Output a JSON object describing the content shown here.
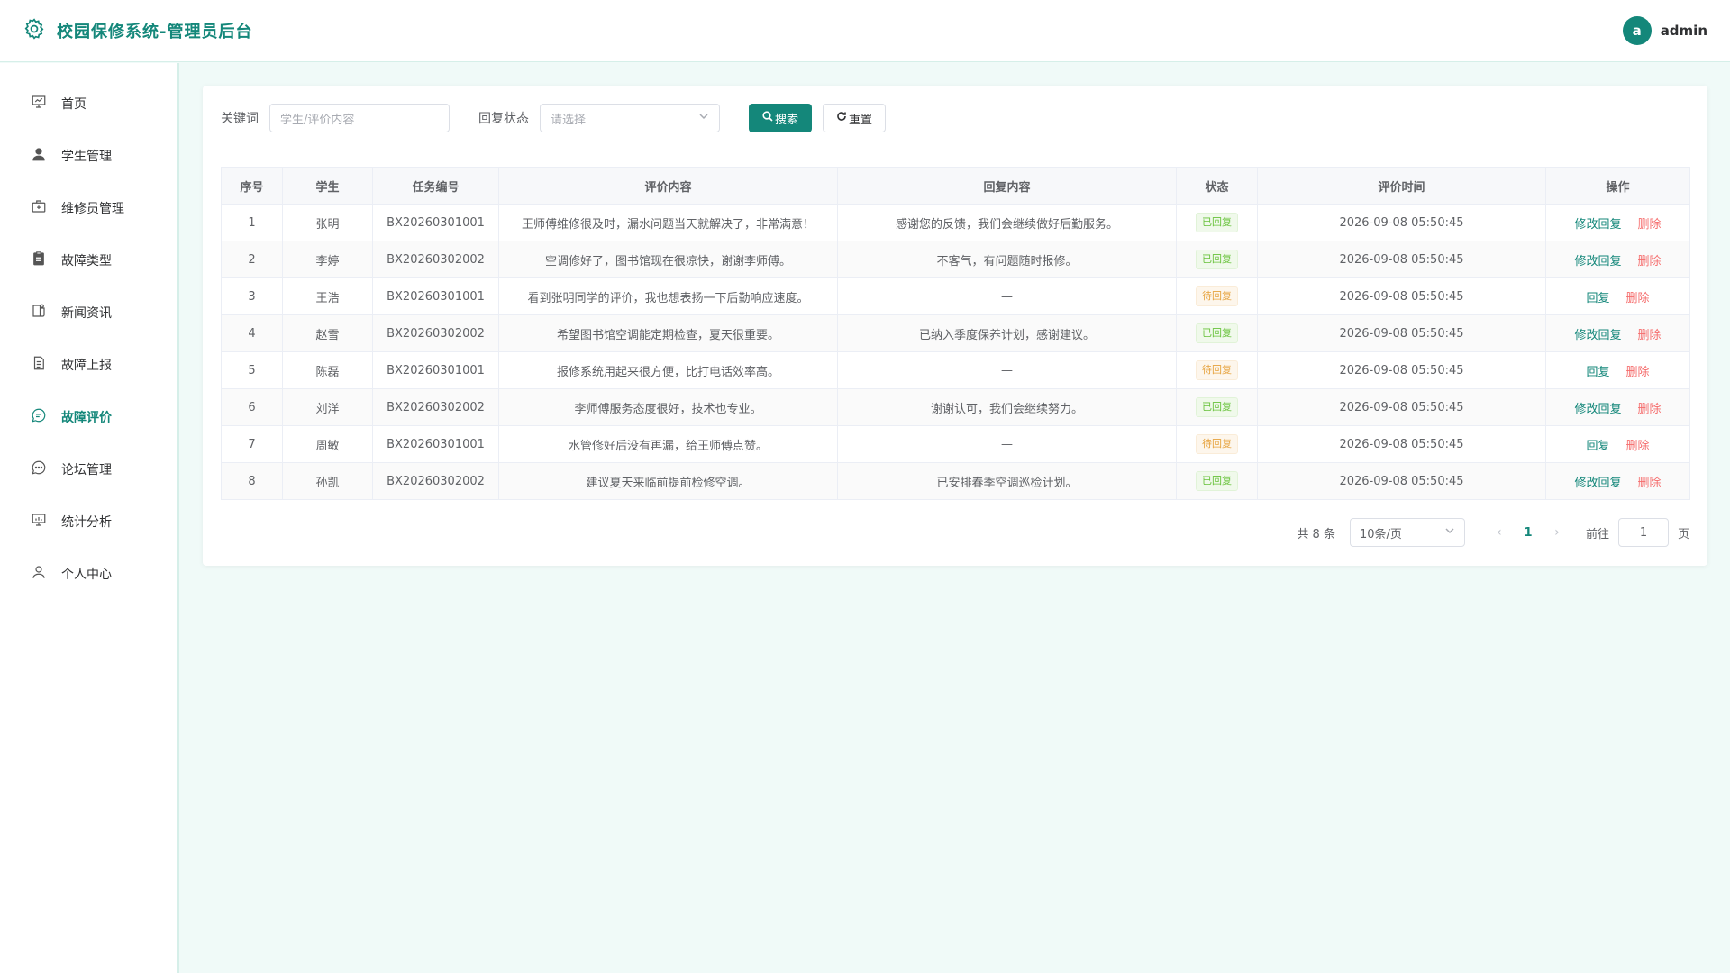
{
  "header": {
    "title": "校园保修系统-管理员后台",
    "avatar_letter": "a",
    "username": "admin"
  },
  "sidebar": {
    "items": [
      {
        "label": "首页",
        "icon": "chalkboard-icon"
      },
      {
        "label": "学生管理",
        "icon": "user-icon"
      },
      {
        "label": "维修员管理",
        "icon": "toolbox-icon"
      },
      {
        "label": "故障类型",
        "icon": "clipboard-icon"
      },
      {
        "label": "新闻资讯",
        "icon": "news-icon"
      },
      {
        "label": "故障上报",
        "icon": "document-icon"
      },
      {
        "label": "故障评价",
        "icon": "chat-icon",
        "active": true
      },
      {
        "label": "论坛管理",
        "icon": "chat-dots-icon"
      },
      {
        "label": "统计分析",
        "icon": "chart-icon"
      },
      {
        "label": "个人中心",
        "icon": "person-icon"
      }
    ]
  },
  "filters": {
    "keyword_label": "关键词",
    "keyword_placeholder": "学生/评价内容",
    "status_label": "回复状态",
    "status_placeholder": "请选择",
    "search_button": "搜索",
    "reset_button": "重置"
  },
  "table": {
    "columns": [
      "序号",
      "学生",
      "任务编号",
      "评价内容",
      "回复内容",
      "状态",
      "评价时间",
      "操作"
    ],
    "rows": [
      {
        "index": "1",
        "student": "张明",
        "task_no": "BX20260301001",
        "content": "王师傅维修很及时，漏水问题当天就解决了，非常满意！",
        "reply": "感谢您的反馈，我们会继续做好后勤服务。",
        "status": "已回复",
        "status_type": "ok",
        "time": "2026-09-08 05:50:45",
        "action": "修改回复",
        "delete": "删除"
      },
      {
        "index": "2",
        "student": "李婷",
        "task_no": "BX20260302002",
        "content": "空调修好了，图书馆现在很凉快，谢谢李师傅。",
        "reply": "不客气，有问题随时报修。",
        "status": "已回复",
        "status_type": "ok",
        "time": "2026-09-08 05:50:45",
        "action": "修改回复",
        "delete": "删除"
      },
      {
        "index": "3",
        "student": "王浩",
        "task_no": "BX20260301001",
        "content": "看到张明同学的评价，我也想表扬一下后勤响应速度。",
        "reply": "—",
        "status": "待回复",
        "status_type": "wait",
        "time": "2026-09-08 05:50:45",
        "action": "回复",
        "delete": "删除"
      },
      {
        "index": "4",
        "student": "赵雪",
        "task_no": "BX20260302002",
        "content": "希望图书馆空调能定期检查，夏天很重要。",
        "reply": "已纳入季度保养计划，感谢建议。",
        "status": "已回复",
        "status_type": "ok",
        "time": "2026-09-08 05:50:45",
        "action": "修改回复",
        "delete": "删除"
      },
      {
        "index": "5",
        "student": "陈磊",
        "task_no": "BX20260301001",
        "content": "报修系统用起来很方便，比打电话效率高。",
        "reply": "—",
        "status": "待回复",
        "status_type": "wait",
        "time": "2026-09-08 05:50:45",
        "action": "回复",
        "delete": "删除"
      },
      {
        "index": "6",
        "student": "刘洋",
        "task_no": "BX20260302002",
        "content": "李师傅服务态度很好，技术也专业。",
        "reply": "谢谢认可，我们会继续努力。",
        "status": "已回复",
        "status_type": "ok",
        "time": "2026-09-08 05:50:45",
        "action": "修改回复",
        "delete": "删除"
      },
      {
        "index": "7",
        "student": "周敏",
        "task_no": "BX20260301001",
        "content": "水管修好后没有再漏，给王师傅点赞。",
        "reply": "—",
        "status": "待回复",
        "status_type": "wait",
        "time": "2026-09-08 05:50:45",
        "action": "回复",
        "delete": "删除"
      },
      {
        "index": "8",
        "student": "孙凯",
        "task_no": "BX20260302002",
        "content": "建议夏天来临前提前检修空调。",
        "reply": "已安排春季空调巡检计划。",
        "status": "已回复",
        "status_type": "ok",
        "time": "2026-09-08 05:50:45",
        "action": "修改回复",
        "delete": "删除"
      }
    ]
  },
  "pagination": {
    "total": "共 8 条",
    "page_size": "10条/页",
    "current_page": "1",
    "goto_label": "前往",
    "goto_value": "1",
    "page_word": "页"
  },
  "colors": {
    "accent": "#14877a",
    "replied": "#67c23a",
    "pending": "#e6a23c",
    "danger": "#f56c6c"
  }
}
